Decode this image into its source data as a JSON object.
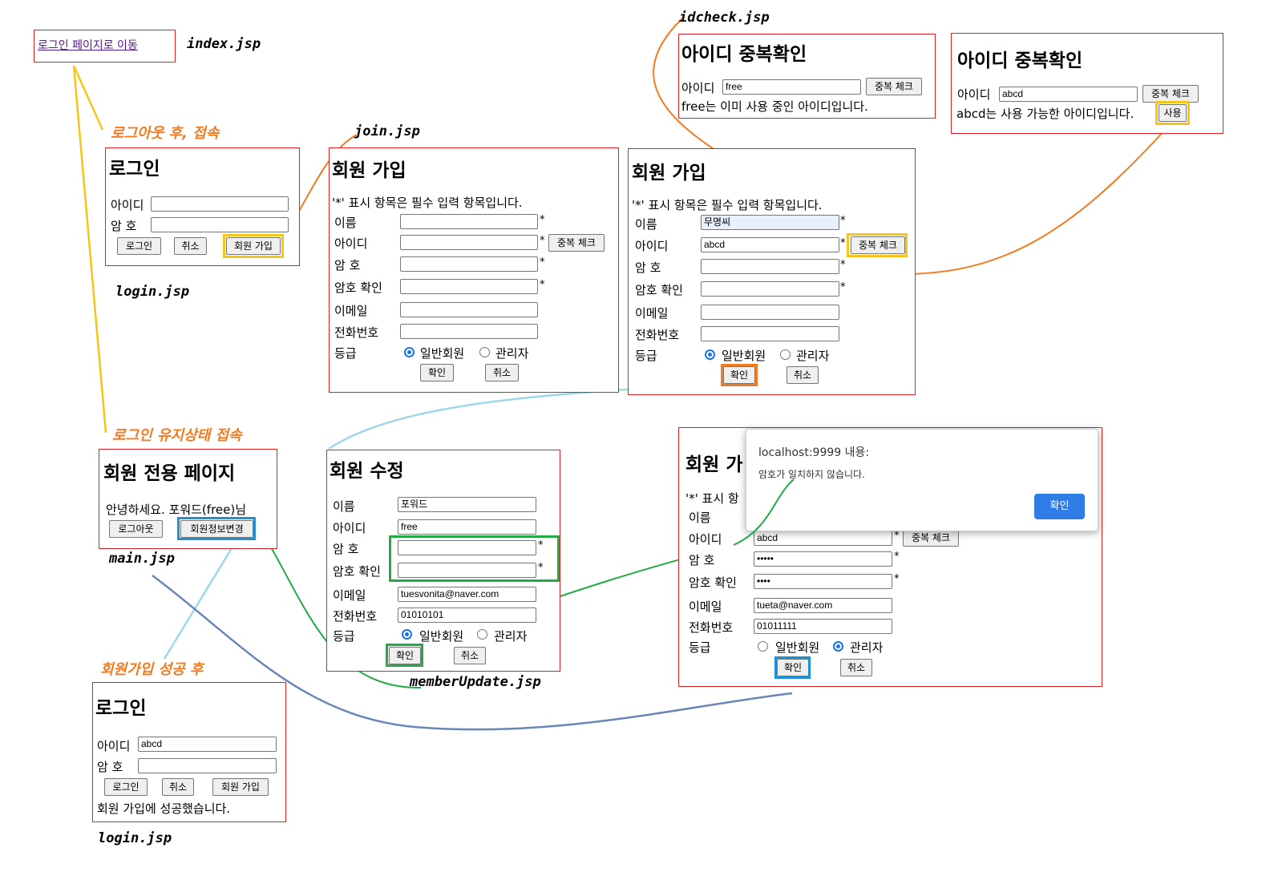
{
  "files": {
    "index": "index.jsp",
    "idcheck": "idcheck.jsp",
    "join": "join.jsp",
    "login1": "login.jsp",
    "main": "main.jsp",
    "memberUpdate": "memberUpdate.jsp",
    "login2": "login.jsp"
  },
  "notes": {
    "after_logout": "로그아웃 후, 접속",
    "logged_in": "로그인 유지상태 접속",
    "after_join": "회원가입 성공 후"
  },
  "colors": {
    "panel_border": "#e02020",
    "yellow": "#f5c518",
    "orange": "#f47a20",
    "light_blue": "#9fd6e8",
    "blue": "#1e90d6",
    "green": "#22aa44",
    "steel_blue": "#6a86b8"
  },
  "index": {
    "link": "로그인 페이지로 이동"
  },
  "login1": {
    "title": "로그인",
    "id_label": "아이디",
    "pw_label": "암 호",
    "btn_login": "로그인",
    "btn_cancel": "취소",
    "btn_join": "회원 가입"
  },
  "join1": {
    "title": "회원 가입",
    "notice": "'*' 표시 항목은 필수 입력 항목입니다.",
    "name_label": "이름",
    "id_label": "아이디",
    "pw_label": "암 호",
    "pw2_label": "암호 확인",
    "email_label": "이메일",
    "phone_label": "전화번호",
    "grade_label": "등급",
    "radio_user": "일반회원",
    "radio_admin": "관리자",
    "btn_check": "중복 체크",
    "btn_ok": "확인",
    "btn_cancel": "취소",
    "star": "*"
  },
  "join2": {
    "title": "회원 가입",
    "notice": "'*' 표시 항목은 필수 입력 항목입니다.",
    "name_label": "이름",
    "name_value": "무명씨",
    "id_label": "아이디",
    "id_value": "abcd",
    "pw_label": "암 호",
    "pw2_label": "암호 확인",
    "email_label": "이메일",
    "phone_label": "전화번호",
    "grade_label": "등급",
    "radio_user": "일반회원",
    "radio_admin": "관리자",
    "btn_check": "중복 체크",
    "btn_ok": "확인",
    "btn_cancel": "취소",
    "star": "*"
  },
  "idcheck1": {
    "title": "아이디 중복확인",
    "id_label": "아이디",
    "id_value": "free",
    "btn_check": "중복 체크",
    "message": "free는 이미 사용 중인 아이디입니다."
  },
  "idcheck2": {
    "title": "아이디 중복확인",
    "id_label": "아이디",
    "id_value": "abcd",
    "btn_check": "중복 체크",
    "message": "abcd는 사용 가능한 아이디입니다.",
    "btn_use": "사용"
  },
  "main": {
    "title": "회원 전용 페이지",
    "greeting": "안녕하세요. 포워드(free)님",
    "btn_logout": "로그아웃",
    "btn_update": "회원정보변경"
  },
  "update": {
    "title": "회원 수정",
    "name_label": "이름",
    "name_value": "포워드",
    "id_label": "아이디",
    "id_value": "free",
    "pw_label": "암    호",
    "pw2_label": "암호 확인",
    "email_label": "이메일",
    "email_value": "tuesvonita@naver.com",
    "phone_label": "전화번호",
    "phone_value": "01010101",
    "grade_label": "등급",
    "radio_user": "일반회원",
    "radio_admin": "관리자",
    "btn_ok": "확인",
    "btn_cancel": "취소",
    "star": "*"
  },
  "join3": {
    "title": "회원 가",
    "notice": "'*' 표시 항",
    "name_label": "이름",
    "id_label": "아이디",
    "id_value": "abcd",
    "pw_label": "암 호",
    "pw_value": "•••••",
    "pw2_label": "암호 확인",
    "pw2_value": "••••",
    "email_label": "이메일",
    "email_value": "tueta@naver.com",
    "phone_label": "전화번호",
    "phone_value": "01011111",
    "grade_label": "등급",
    "radio_user": "일반회원",
    "radio_admin": "관리자",
    "btn_check": "중복 체크",
    "btn_ok": "확인",
    "btn_cancel": "취소",
    "star": "*"
  },
  "dialog": {
    "origin": "localhost:9999 내용:",
    "message": "암호가 일치하지 않습니다.",
    "btn_ok": "확인"
  },
  "login2": {
    "title": "로그인",
    "id_label": "아이디",
    "id_value": "abcd",
    "pw_label": "암 호",
    "btn_login": "로그인",
    "btn_cancel": "취소",
    "btn_join": "회원 가입",
    "message": "회원 가입에 성공했습니다."
  }
}
